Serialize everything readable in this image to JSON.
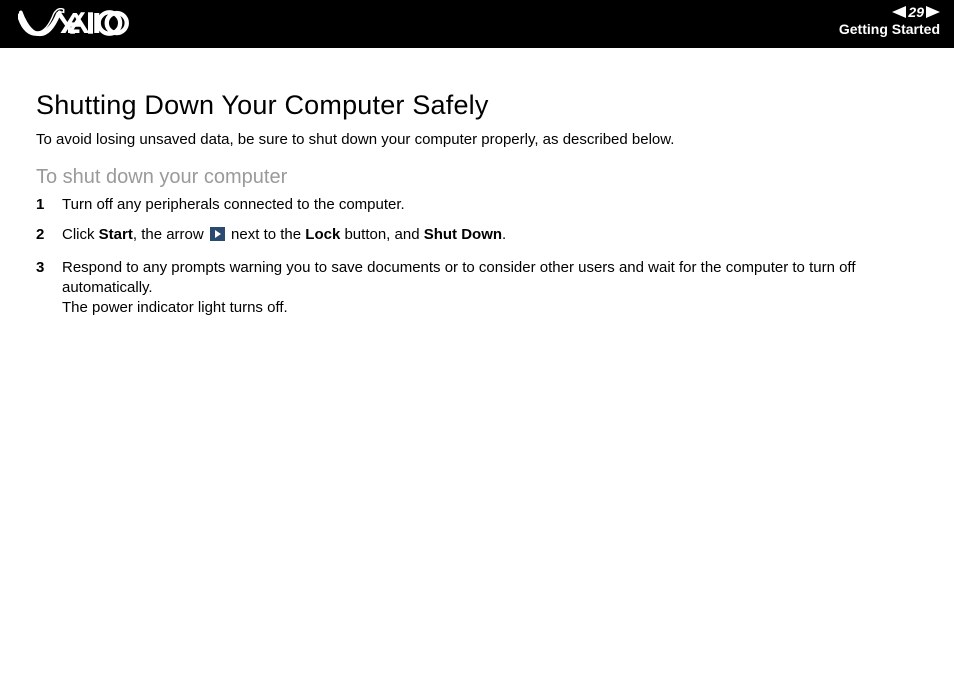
{
  "header": {
    "page_number": "29",
    "section": "Getting Started"
  },
  "content": {
    "title": "Shutting Down Your Computer Safely",
    "intro": "To avoid losing unsaved data, be sure to shut down your computer properly, as described below.",
    "subhead": "To shut down your computer",
    "steps": {
      "s1": "Turn off any peripherals connected to the computer.",
      "s2_a": "Click ",
      "s2_bold1": "Start",
      "s2_b": ", the arrow ",
      "s2_c": " next to the ",
      "s2_bold2": "Lock",
      "s2_d": " button, and ",
      "s2_bold3": "Shut Down",
      "s2_e": ".",
      "s3_a": "Respond to any prompts warning you to save documents or to consider other users and wait for the computer to turn off automatically.",
      "s3_b": "The power indicator light turns off."
    }
  }
}
